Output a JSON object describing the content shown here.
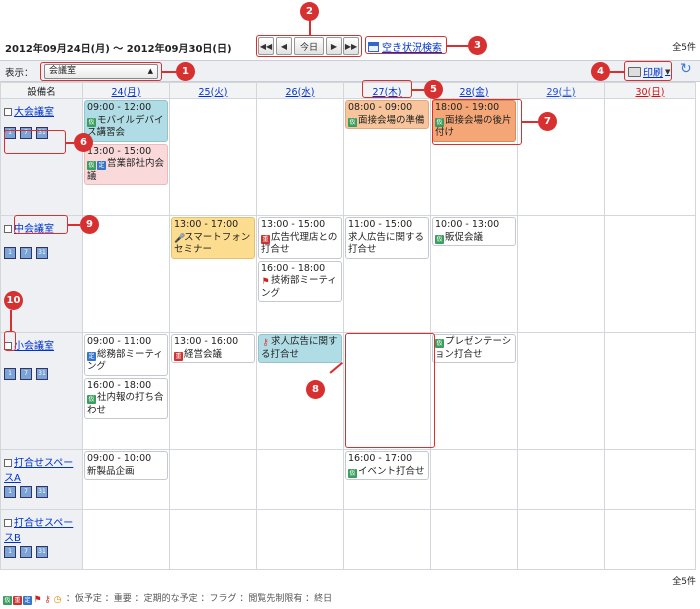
{
  "header": {
    "date_range": "2012年09月24日(月) 〜 2012年09月30日(日)",
    "nav": {
      "first": "◀◀",
      "prev": "◀",
      "today": "今日",
      "next": "▶",
      "last": "▶▶"
    },
    "search_link": "空き状況検索",
    "total_top": "全5件"
  },
  "toolbar": {
    "display_label": "表示：",
    "display_value": "会議室",
    "print_label": "印刷",
    "refresh": "↻"
  },
  "table": {
    "facility_header": "設備名",
    "days": [
      "24(月)",
      "25(火)",
      "26(水)",
      "27(木)",
      "28(金)",
      "29(土)",
      "30(日)"
    ],
    "facilities": [
      {
        "name": "大会議室"
      },
      {
        "name": "中会議室"
      },
      {
        "name": "小会議室"
      },
      {
        "name": "打合せスペースA"
      },
      {
        "name": "打合せスペースB"
      }
    ],
    "view_buttons": [
      "1",
      "7",
      "31"
    ],
    "events": {
      "r0d0a": {
        "time": "09:00 - 12:00",
        "title": "モバイルデバイス講習会"
      },
      "r0d0b": {
        "time": "13:00 - 15:00",
        "title": "営業部社内会議"
      },
      "r0d3": {
        "time": "08:00 - 09:00",
        "title": "面接会場の準備"
      },
      "r0d4": {
        "time": "18:00 - 19:00",
        "title": "面接会場の後片付け"
      },
      "r1d1": {
        "time": "13:00 - 17:00",
        "title": "スマートフォンセミナー"
      },
      "r1d2a": {
        "time": "13:00 - 15:00",
        "title": "広告代理店との打合せ"
      },
      "r1d2b": {
        "time": "16:00 - 18:00",
        "title": "技術部ミーティング"
      },
      "r1d3": {
        "time": "11:00 - 15:00",
        "title": "求人広告に関する打合せ"
      },
      "r1d4": {
        "time": "10:00 - 13:00",
        "title": "販促会議"
      },
      "r2d0a": {
        "time": "09:00 - 11:00",
        "title": "総務部ミーティング"
      },
      "r2d0b": {
        "time": "16:00 - 18:00",
        "title": "社内報の打ち合わせ"
      },
      "r2d1": {
        "time": "13:00 - 16:00",
        "title": "経営会議"
      },
      "r2d2": {
        "title": "求人広告に関する打合せ"
      },
      "r2d4": {
        "title": "プレゼンテーション打合せ"
      },
      "r3d0": {
        "time": "09:00 - 10:00",
        "title": "新製品企画"
      },
      "r3d3": {
        "time": "16:00 - 17:00",
        "title": "イベント打合せ"
      }
    }
  },
  "icons": {
    "tentative": "仮",
    "important": "重",
    "regular": "定"
  },
  "footer": {
    "total_bottom": "全5件",
    "legend": "：仮予定  ：重要  ：定期的な予定  ：フラグ  ：閲覧先制限有  ：終日"
  },
  "callouts": [
    "1",
    "2",
    "3",
    "4",
    "5",
    "6",
    "7",
    "8",
    "9",
    "10"
  ],
  "colors": {
    "callout": "#d63031",
    "teal_event": "#b0dde5",
    "pink_event": "#f9d9d9",
    "yellow_event": "#fcdc8e",
    "orange_event": "#f8c49b",
    "link": "#0033cc"
  }
}
